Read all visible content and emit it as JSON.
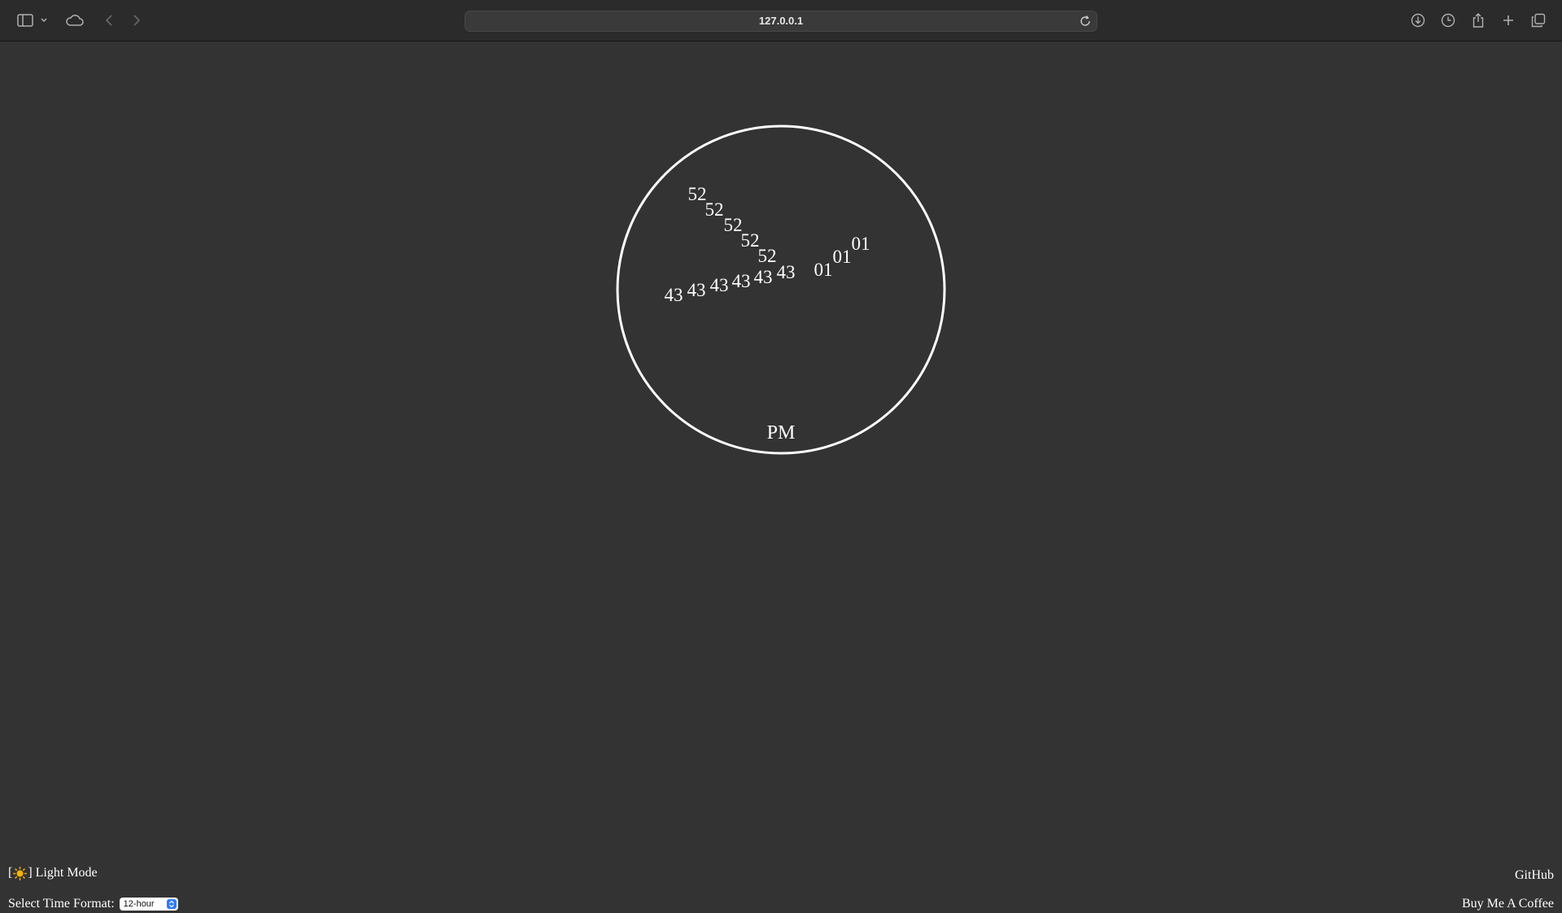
{
  "browser": {
    "url": "127.0.0.1",
    "icons": [
      "sidebar-icon",
      "chevron-down-icon",
      "cloud-icon",
      "back-icon",
      "forward-icon",
      "reload-icon",
      "download-icon",
      "history-icon",
      "share-icon",
      "new-tab-icon",
      "tabs-overview-icon"
    ]
  },
  "clock": {
    "hours": [
      "01",
      "01",
      "01"
    ],
    "minutes": [
      "52",
      "52",
      "52",
      "52",
      "52"
    ],
    "seconds": [
      "43",
      "43",
      "43",
      "43",
      "43",
      "43"
    ],
    "meridiem": "PM"
  },
  "footer": {
    "theme_toggle": {
      "bracket_open": "[",
      "icon": "sun-icon",
      "bracket_close": "]",
      "label": "Light Mode"
    },
    "time_format": {
      "label": "Select Time Format:",
      "selected": "12-hour"
    },
    "github_label": "GitHub",
    "coffee_label": "Buy Me A Coffee"
  },
  "colors": {
    "background": "#333333",
    "foreground": "#ffffff",
    "toolbar": "#2b2b2b",
    "select_accent": "#2f7cf6"
  }
}
